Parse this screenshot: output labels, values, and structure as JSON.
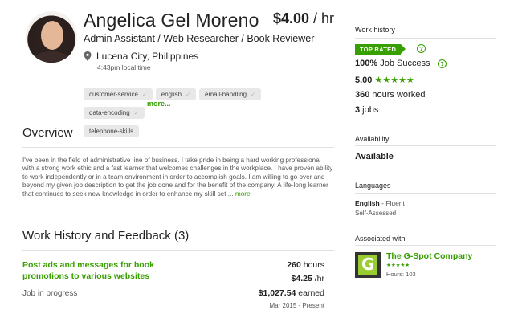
{
  "profile": {
    "name": "Angelica Gel Moreno",
    "rate_amount": "$4.00",
    "rate_unit": " / hr",
    "title": "Admin Assistant / Web Researcher / Book Reviewer",
    "location": "Lucena City, Philippines",
    "local_time": "4:43pm local time",
    "skills": [
      "customer-service",
      "english",
      "email-handling",
      "data-encoding",
      "telephone-skills"
    ],
    "more_skills_link": "more..."
  },
  "overview": {
    "heading": "Overview",
    "text": "I've been in the field of administrative line of business. I take pride in being a hard working professional with a strong work ethic and a fast learner that welcomes challenges in the workplace. I have proven ability to work independently or in a team environment in order to accomplish goals. I am willing to go over and beyond my given job description to get the job done and for the benefit of the company. A life-long learner that continues to seek new knowledge in order to enhance my skill set ...",
    "more_link": "more"
  },
  "work_history_section": {
    "heading": "Work History and Feedback (3)",
    "jobs": [
      {
        "title": "Post ads and messages for book promotions to various websites",
        "hours_value": "260",
        "hours_label": " hours",
        "rate": "$4.25",
        "rate_unit": " /hr",
        "status": "Job in progress",
        "earned_value": "$1,027.54",
        "earned_label": " earned",
        "dates": "Mar 2015 - Present"
      }
    ]
  },
  "sidebar": {
    "work_history_label": "Work history",
    "top_rated_badge": "TOP RATED",
    "job_success_value": "100%",
    "job_success_label": " Job Success",
    "rating_value": "5.00",
    "rating_stars": "★★★★★",
    "hours_value": "360",
    "hours_label": " hours worked",
    "jobs_value": "3",
    "jobs_label": " jobs",
    "availability_label": "Availability",
    "availability_value": "Available",
    "languages_label": "Languages",
    "language_name": "English",
    "language_level": " - Fluent",
    "language_assessment": "Self-Assessed",
    "associated_label": "Associated with",
    "association": {
      "name": "The G-Spot Company",
      "stars": "★★★★★",
      "hours": "Hours: 103",
      "logo_letter": "G"
    },
    "help_icon_glyph": "?"
  },
  "colors": {
    "accent_green": "#37a000",
    "tag_bg": "#e8e8e8",
    "divider": "#e0e0e0"
  },
  "icons": [
    "location-pin-icon",
    "check-icon",
    "help-icon",
    "star-icon"
  ]
}
